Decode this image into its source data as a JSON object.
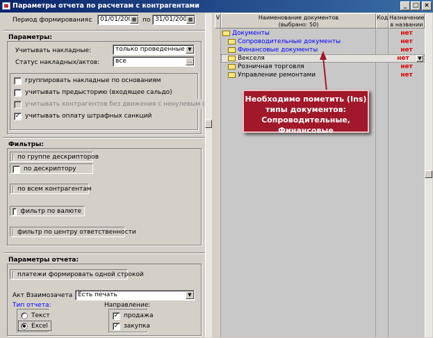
{
  "window": {
    "title": "Параметры отчета по расчетам с контрагентами"
  },
  "period": {
    "label": "Период формирования:",
    "from_label": "с",
    "from_value": "01/01/2008",
    "to_label": "по",
    "to_value": "31/01/2008"
  },
  "params": {
    "header": "Параметры:",
    "invoices_label": "Учитывать накладные:",
    "invoices_value": "только проведенные",
    "status_label": "Статус накладных/актов:",
    "status_value": "все",
    "checkboxes": [
      {
        "label": "группировать накладные по основаниям",
        "checked": false
      },
      {
        "label": "учитывать предысторию (входящее сальдо)",
        "checked": false
      },
      {
        "label": "учитывать контрагентов без движения с ненулевым сальдо",
        "checked": false
      },
      {
        "label": "учитывать оплату штрафных санкций",
        "checked": true
      }
    ]
  },
  "filters": {
    "header": "Фильтры:",
    "items": [
      "по группе дескрипторов",
      "по дескриптору",
      "по всем контрагентам",
      "фильтр по валюте",
      "фильтр по центру ответственности"
    ]
  },
  "report": {
    "header": "Параметры отчета:",
    "single_line_label": "платежи формировать одной строкой",
    "act_label": "Акт Взаимозачета",
    "act_value": "Есть печать",
    "type_label": "Тип отчета:",
    "type_options": [
      "Текст",
      "Excel"
    ],
    "type_selected": "Excel",
    "direction_label": "Направление:",
    "directions": [
      {
        "label": "продажа",
        "checked": true
      },
      {
        "label": "закупка",
        "checked": true
      }
    ]
  },
  "grid": {
    "col_v": "V",
    "col_name": "Наименование документов",
    "col_name_sub": "(выбрано: 50)",
    "col_code": "Код",
    "col_purpose_1": "Назначение",
    "col_purpose_2": "в названии",
    "rows": [
      {
        "name": "Документы",
        "level": 0,
        "folder": true,
        "style": "link",
        "purpose": "нет"
      },
      {
        "name": "Сопроводительные документы",
        "level": 1,
        "folder": true,
        "style": "link",
        "purpose": "нет"
      },
      {
        "name": "Финансовые документы",
        "level": 1,
        "folder": true,
        "style": "link",
        "purpose": "нет"
      },
      {
        "name": "Векселя",
        "level": 1,
        "folder": true,
        "style": "plain",
        "purpose": "нет"
      },
      {
        "name": "Розничная торговля",
        "level": 1,
        "folder": true,
        "style": "plain",
        "purpose": "нет"
      },
      {
        "name": "Управление ремонтами",
        "level": 1,
        "folder": true,
        "style": "plain",
        "purpose": "нет"
      }
    ]
  },
  "callout": {
    "lines": [
      "Необходимо пометить (Ins)",
      "типы документов:",
      "Сопроводительные,",
      "Финансовые"
    ]
  },
  "colors": {
    "title_bar": "#0a246a",
    "link_text": "#0000ff",
    "no_text": "#e00000",
    "callout_bg": "#a0182a",
    "folder": "#ffe680"
  }
}
